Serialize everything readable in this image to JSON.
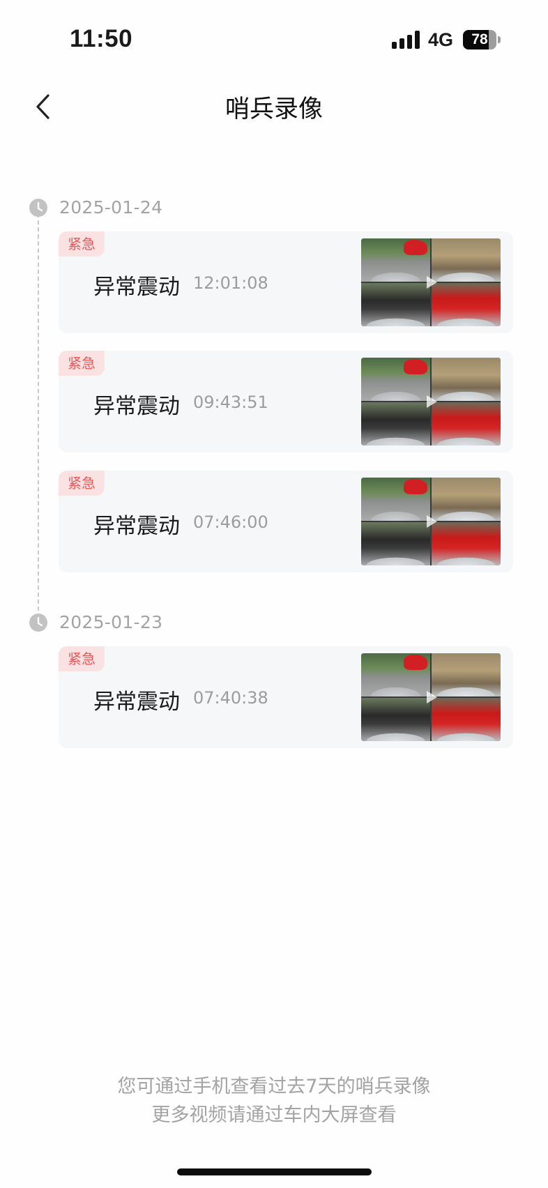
{
  "status_bar": {
    "time": "11:50",
    "network": "4G",
    "battery_level": "78",
    "battery_fraction": 0.78
  },
  "header": {
    "title": "哨兵录像",
    "back_icon": "chevron-left-icon"
  },
  "groups": [
    {
      "date": "2025-01-24",
      "records": [
        {
          "badge": "紧急",
          "event": "异常震动",
          "time": "12:01:08"
        },
        {
          "badge": "紧急",
          "event": "异常震动",
          "time": "09:43:51"
        },
        {
          "badge": "紧急",
          "event": "异常震动",
          "time": "07:46:00"
        }
      ]
    },
    {
      "date": "2025-01-23",
      "records": [
        {
          "badge": "紧急",
          "event": "异常震动",
          "time": "07:40:38"
        }
      ]
    }
  ],
  "footer": {
    "line1": "您可通过手机查看过去7天的哨兵录像",
    "line2": "更多视频请通过车内大屏查看"
  },
  "colors": {
    "badge_bg": "#fbe2e2",
    "badge_text": "#ea5a5a",
    "card_bg": "#f6f7f9",
    "muted_text": "#a3a3a3"
  }
}
